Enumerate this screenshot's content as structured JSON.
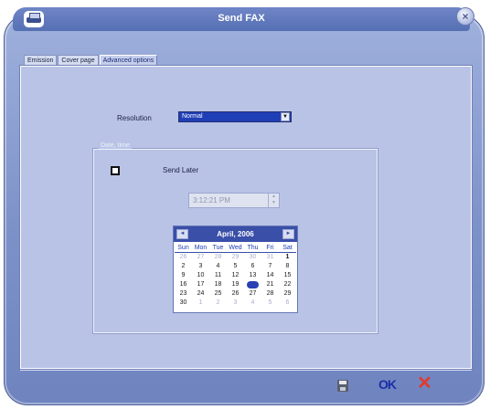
{
  "window": {
    "title": "Send FAX",
    "close_glyph": "×"
  },
  "tabs": [
    {
      "label": "Emission",
      "active": false
    },
    {
      "label": "Cover page",
      "active": false
    },
    {
      "label": "Advanced options",
      "active": true
    }
  ],
  "resolution": {
    "label": "Resolution",
    "selected": "Normal",
    "arrow": "▼"
  },
  "date_time_group": {
    "legend": "Date, time"
  },
  "send_later": {
    "label": "Send Later",
    "checked": false
  },
  "time_field": {
    "value": "3:12:21 PM",
    "up": "▲",
    "down": "▼"
  },
  "calendar": {
    "title": "April, 2006",
    "prev": "◄",
    "next": "►",
    "days_of_week": [
      "Sun",
      "Mon",
      "Tue",
      "Wed",
      "Thu",
      "Fri",
      "Sat"
    ],
    "weeks": [
      [
        "26",
        "27",
        "28",
        "29",
        "30",
        "31",
        "1"
      ],
      [
        "2",
        "3",
        "4",
        "5",
        "6",
        "7",
        "8"
      ],
      [
        "9",
        "10",
        "11",
        "12",
        "13",
        "14",
        "15"
      ],
      [
        "16",
        "17",
        "18",
        "19",
        "20",
        "21",
        "22"
      ],
      [
        "23",
        "24",
        "25",
        "26",
        "27",
        "28",
        "29"
      ],
      [
        "30",
        "1",
        "2",
        "3",
        "4",
        "5",
        "6"
      ]
    ],
    "selected_day": "20"
  },
  "footer": {
    "ok_label": "OK",
    "cancel_label": "✕",
    "save_icon": "save-icon"
  },
  "colors": {
    "accent": "#3a4fa8",
    "ok": "#1c2ea8",
    "cancel": "#e03b2c",
    "selection": "#1f3fb6"
  }
}
